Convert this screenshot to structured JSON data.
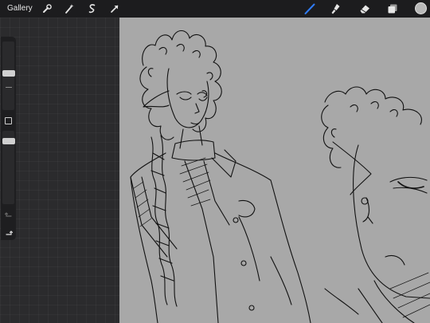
{
  "toolbar": {
    "gallery_label": "Gallery",
    "left_tools": [
      {
        "name": "wrench-icon"
      },
      {
        "name": "magic-wand-icon"
      },
      {
        "name": "selection-icon"
      },
      {
        "name": "transform-arrow-icon"
      }
    ],
    "right_tools": [
      {
        "name": "brush-icon",
        "active": true,
        "color": "#2f7bf5"
      },
      {
        "name": "smudge-icon"
      },
      {
        "name": "eraser-icon"
      },
      {
        "name": "layers-icon"
      }
    ],
    "current_color": "#b8b8b8"
  },
  "sidebar": {
    "brush_size_level": 0.18,
    "opacity_level": 0.45,
    "undo_icon": "undo-icon",
    "redo_icon": "redo-icon"
  },
  "canvas": {
    "background": "#a8a8a8",
    "content": "sketch-drawing"
  }
}
